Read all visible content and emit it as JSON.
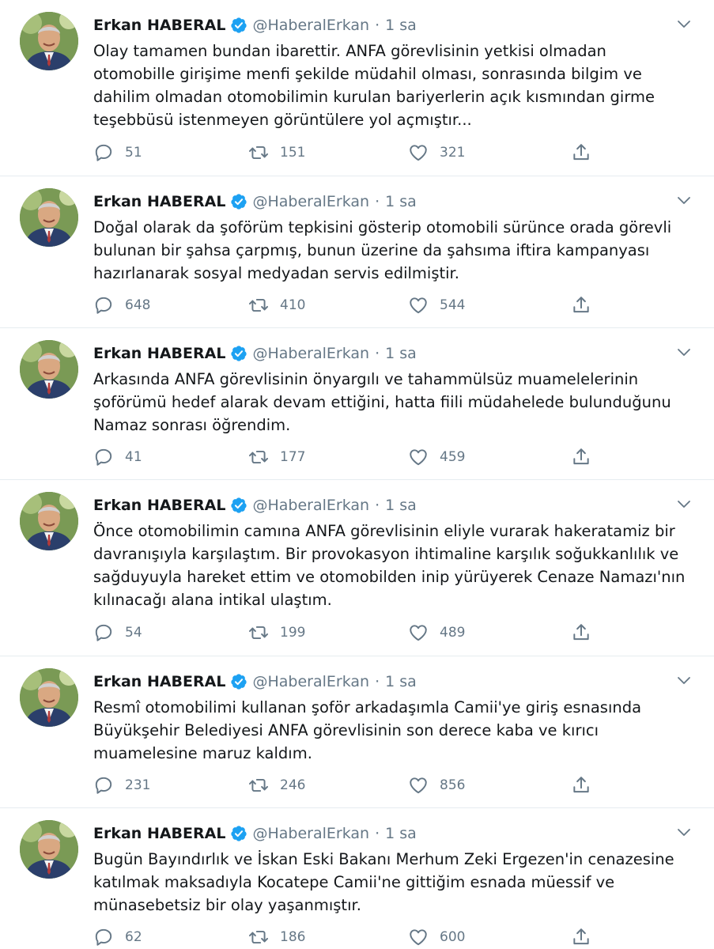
{
  "author": {
    "name": "Erkan HABERAL",
    "handle": "@HaberalErkan",
    "separator": "·",
    "verified_icon": "verified-badge-icon"
  },
  "colors": {
    "verified": "#1da1f2",
    "muted_text": "#657786",
    "divider": "#e6ecf0"
  },
  "tweets": [
    {
      "time": "1 sa",
      "lines": [
        "Olay tamamen bundan ibarettir. ANFA görevlisinin yetkisi olmadan",
        "otomobille girişime menfi şekilde müdahil olması, sonrasında bilgim ve",
        "dahilim olmadan otomobilimin kurulan bariyerlerin açık kısmından girme",
        "teşebbüsü istenmeyen görüntülere yol açmıştır..."
      ],
      "replies": "51",
      "retweets": "151",
      "likes": "321"
    },
    {
      "time": "1 sa",
      "lines": [
        "Doğal olarak da şoförüm tepkisini gösterip otomobili sürünce orada görevli",
        "bulunan bir şahsa çarpmış, bunun üzerine da şahsıma iftira kampanyası",
        "hazırlanarak sosyal medyadan servis edilmiştir."
      ],
      "replies": "648",
      "retweets": "410",
      "likes": "544"
    },
    {
      "time": "1 sa",
      "lines": [
        "Arkasında ANFA görevlisinin önyargılı ve tahammülsüz muamelelerinin",
        "şoförümü hedef alarak devam ettiğini, hatta fiili müdahelede bulunduğunu",
        "Namaz sonrası öğrendim."
      ],
      "replies": "41",
      "retweets": "177",
      "likes": "459"
    },
    {
      "time": "1 sa",
      "lines": [
        "Önce otomobilimin camına ANFA görevlisinin eliyle vurarak hakeratamiz bir",
        "davranışıyla karşılaştım. Bir provokasyon ihtimaline karşılık soğukkanlılık ve",
        "sağduyuyla hareket ettim ve otomobilden inip yürüyerek Cenaze Namazı'nın",
        "kılınacağı alana intikal ulaştım."
      ],
      "replies": "54",
      "retweets": "199",
      "likes": "489"
    },
    {
      "time": "1 sa",
      "lines": [
        "Resmî otomobilimi kullanan şoför arkadaşımla Camii'ye giriş esnasında",
        "Büyükşehir Belediyesi ANFA görevlisinin son derece kaba ve kırıcı",
        "muamelesine maruz kaldım."
      ],
      "replies": "231",
      "retweets": "246",
      "likes": "856"
    },
    {
      "time": "1 sa",
      "lines": [
        "Bugün Bayındırlık ve İskan Eski Bakanı Merhum Zeki Ergezen'in cenazesine",
        "katılmak maksadıyla Kocatepe Camii'ne gittiğim esnada müessif ve",
        "münasebetsiz bir olay yaşanmıştır."
      ],
      "replies": "62",
      "retweets": "186",
      "likes": "600"
    }
  ]
}
